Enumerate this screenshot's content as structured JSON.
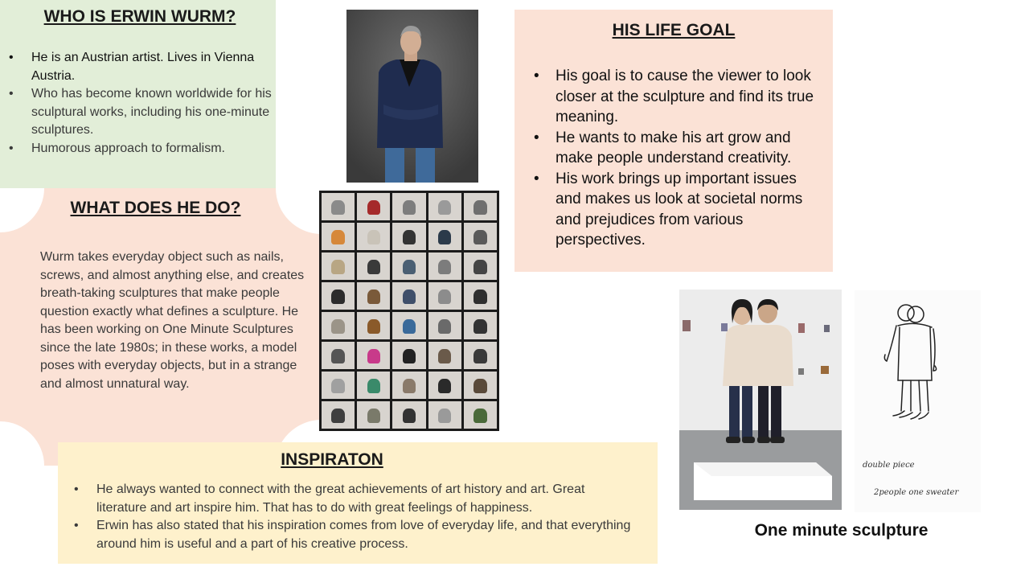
{
  "who": {
    "title": "WHO IS ERWIN WURM?",
    "bullets": [
      "He is an Austrian artist. Lives in Vienna Austria.",
      "Who has become known worldwide for his sculptural works, including his one-minute sculptures.",
      "Humorous approach to formalism."
    ]
  },
  "what": {
    "title": "WHAT DOES HE DO?",
    "text": "Wurm takes everyday object such as nails, screws, and almost anything else, and creates breath-taking sculptures that make people question exactly what defines a sculpture. He has been working on One Minute Sculptures since the late 1980s; in these works, a model poses with everyday objects, but in a strange and almost unnatural way."
  },
  "goal": {
    "title": "HIS LIFE GOAL",
    "bullets": [
      "His goal is to cause the viewer to look closer at the sculpture and find its true meaning.",
      "He wants to make his art grow and make people understand creativity.",
      "His work brings up important issues and makes us look at societal norms and prejudices from various perspectives."
    ]
  },
  "inspiration": {
    "title": "INSPIRATON",
    "bullets": [
      "He always wanted to connect with the great achievements of art history and art. Great literature and art inspire him. That has to do with great feelings of happiness.",
      "Erwin has also stated that his inspiration comes from love of everyday life, and that everything around him is useful and a part of his creative process."
    ]
  },
  "sketch": {
    "line1": "double piece",
    "line2": "2people one sweater"
  },
  "caption": "One minute sculpture",
  "colors": {
    "green_box": "#e2eed8",
    "peach_box": "#fbe2d6",
    "yellow_box": "#fef1cc"
  }
}
